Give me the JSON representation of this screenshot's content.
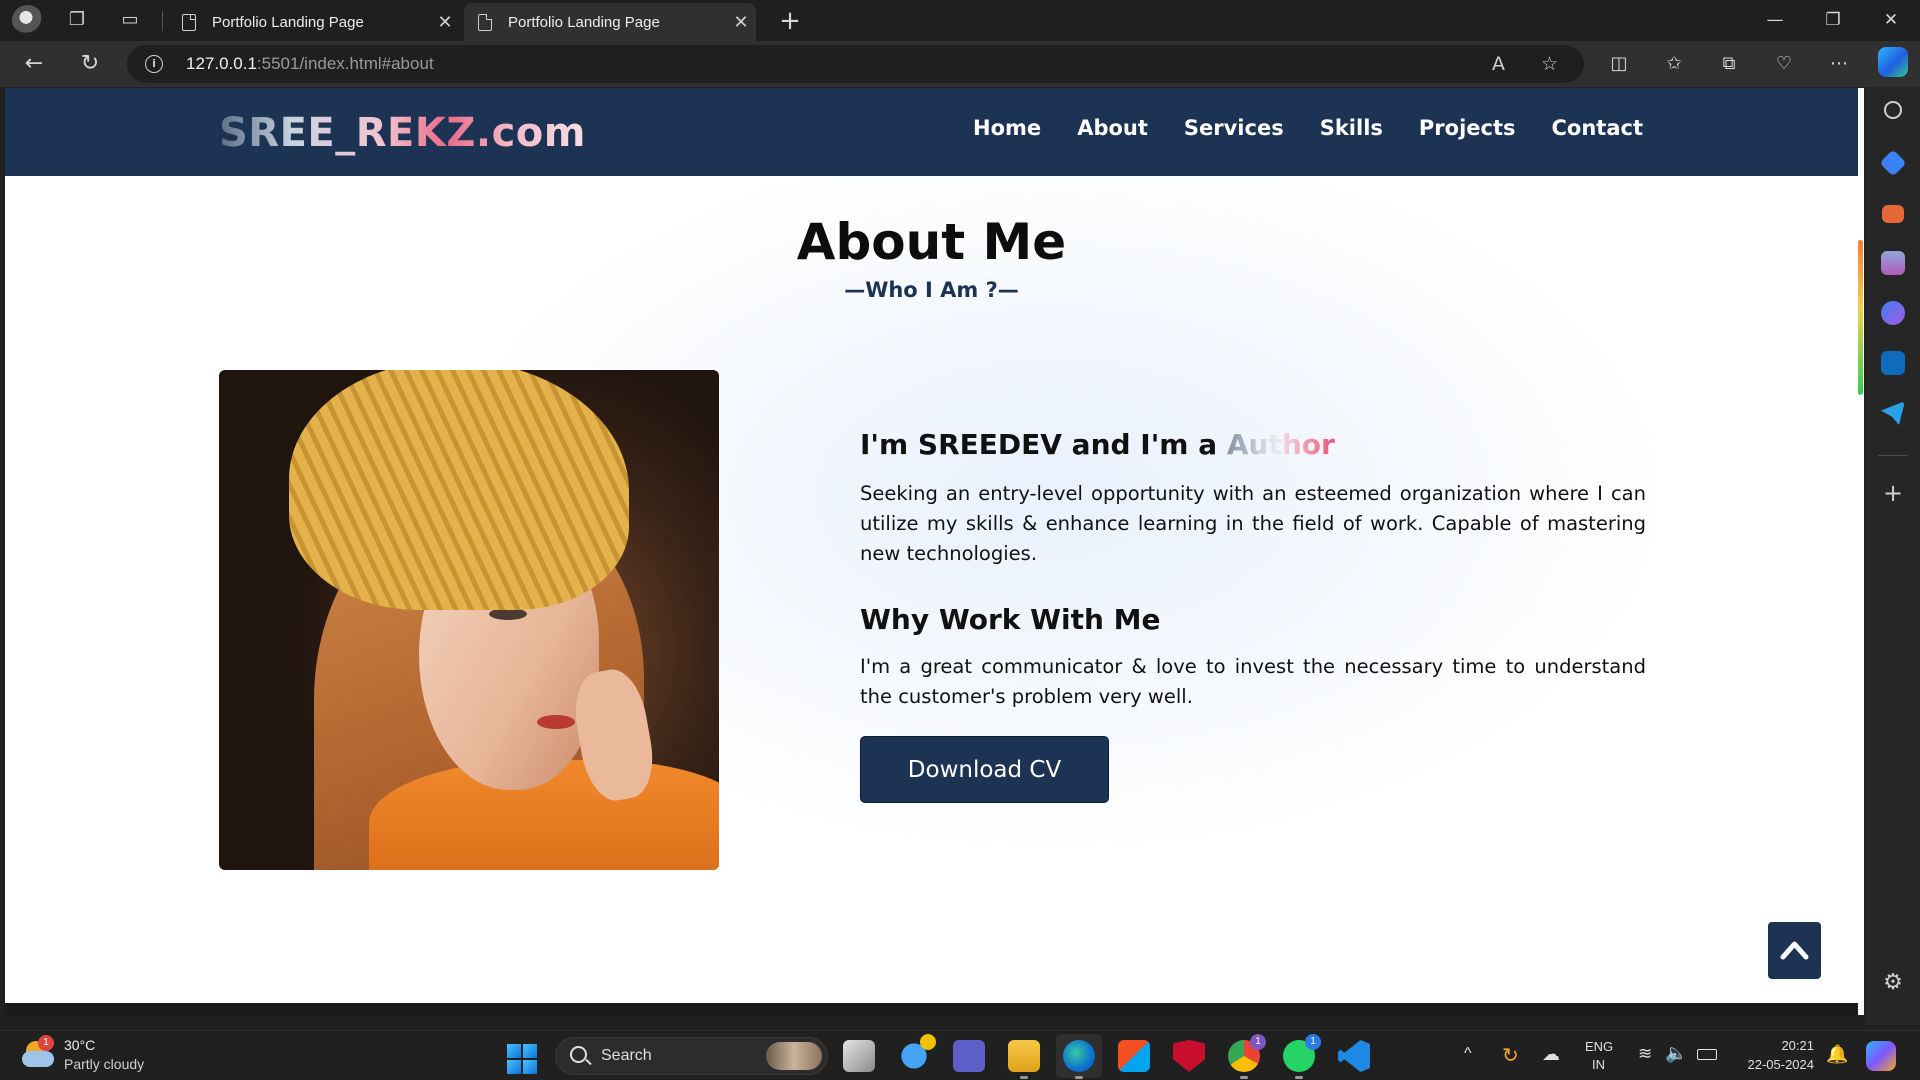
{
  "browser": {
    "tabs": [
      {
        "title": "Portfolio Landing Page",
        "active": false
      },
      {
        "title": "Portfolio Landing Page",
        "active": true
      }
    ],
    "url_host": "127.0.0.1",
    "url_path": ":5501/index.html#about"
  },
  "site": {
    "logo": "SREE_REKZ.com",
    "nav": [
      "Home",
      "About",
      "Services",
      "Skills",
      "Projects",
      "Contact"
    ]
  },
  "about": {
    "title": "About Me",
    "subtitle": "—Who I Am ?—",
    "intro_prefix": "I'm SREEDEV and I'm a ",
    "intro_typed": "Author",
    "intro_text": "Seeking an entry-level opportunity with an esteemed organization where I can utilize my skills & enhance learning in the field of work. Capable of mastering new technologies.",
    "why_heading": "Why Work With Me",
    "why_text": "I'm a great communicator & love to invest the necessary time to understand the customer's problem very well.",
    "cv_button": "Download CV"
  },
  "taskbar": {
    "weather_temp": "30°C",
    "weather_desc": "Partly cloudy",
    "weather_badge": "1",
    "search_label": "Search",
    "lang_line1": "ENG",
    "lang_line2": "IN",
    "time": "20:21",
    "date": "22-05-2024",
    "chrome_badge": "1",
    "whatsapp_badge": "1"
  },
  "colors": {
    "header_navy": "#1c3354",
    "accent_pink": "#e55377"
  },
  "icons": {
    "back": "arrow-left-icon",
    "refresh": "refresh-icon",
    "to_top": "chevron-up-icon"
  }
}
